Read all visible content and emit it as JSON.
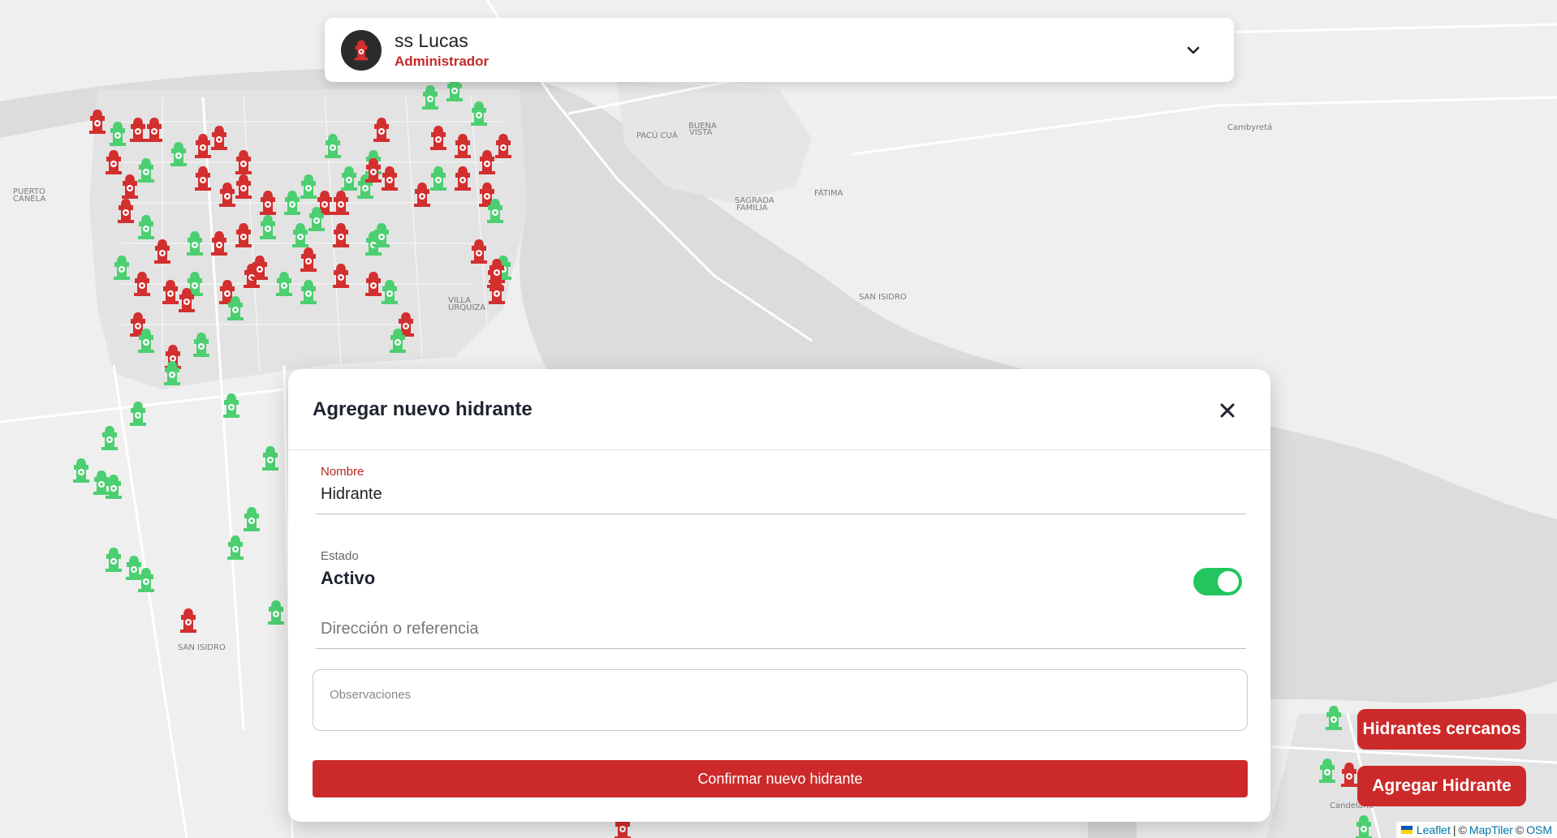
{
  "user": {
    "name": "ss Lucas",
    "role": "Administrador"
  },
  "map": {
    "place_labels": [
      "Cambyretá",
      "PACÚ CUÁ",
      "BUENA VISTA",
      "SAGRADA FAMILIA",
      "FÁTIMA",
      "SAN ISIDRO",
      "PUERTO CANELA",
      "VILLA URQUIZA",
      "Candelaria",
      "SAN ISIDRO"
    ],
    "markers": {
      "active_color": "#4ccf71",
      "inactive_color": "#d32f2f",
      "icon": "hydrant-icon"
    }
  },
  "modal": {
    "title": "Agregar nuevo hidrante",
    "nombre_label": "Nombre",
    "nombre_value": "Hidrante",
    "estado_label": "Estado",
    "estado_value": "Activo",
    "estado_on": true,
    "direccion_placeholder": "Dirección o referencia",
    "observaciones_placeholder": "Observaciones",
    "confirm_label": "Confirmar nuevo hidrante"
  },
  "fabs": {
    "nearby_label": "Hidrantes cercanos",
    "add_label": "Agregar Hidrante"
  },
  "attribution": {
    "leaflet": "Leaflet",
    "sep1": "|",
    "copy1": "©",
    "maptiler": "MapTiler",
    "copy2": "©",
    "osm": "OSM"
  },
  "colors": {
    "brand_red": "#cc2a2a",
    "toggle_green": "#22c55e"
  }
}
